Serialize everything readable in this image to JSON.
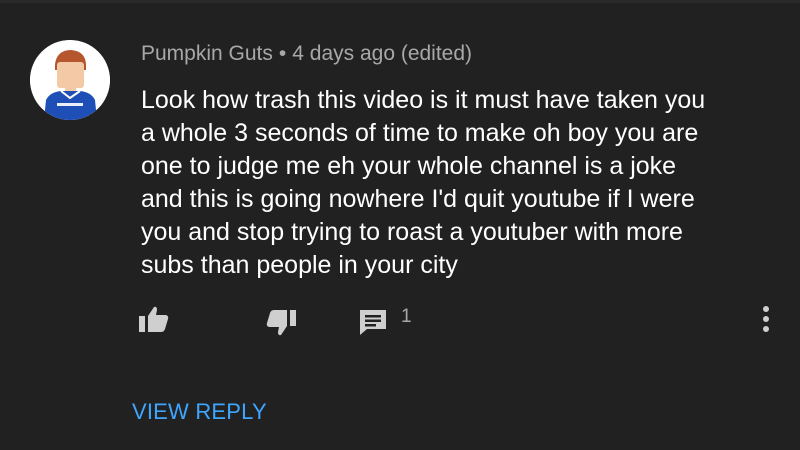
{
  "comment": {
    "author": "Pumpkin Guts",
    "separator": "•",
    "timestamp": "4 days ago (edited)",
    "text_lines": [
      "Look how trash this video is it must have taken you",
      "a whole 3 seconds of time to make oh boy you are",
      "one to judge me eh your whole channel is a joke",
      "and this is going nowhere I'd quit youtube if I were",
      "you and stop trying to roast a youtuber with more",
      "subs than people in your city"
    ]
  },
  "actions": {
    "like_icon": "thumbs-up-icon",
    "dislike_icon": "thumbs-down-icon",
    "reply_icon": "comment-icon",
    "reply_count": "1",
    "more_icon": "more-vertical-icon"
  },
  "view_reply_label": "VIEW REPLY",
  "colors": {
    "background": "#212121",
    "text": "#ffffff",
    "secondary_text": "#a8a8a8",
    "link": "#3ea6ff",
    "icon": "#cfcfcf"
  }
}
